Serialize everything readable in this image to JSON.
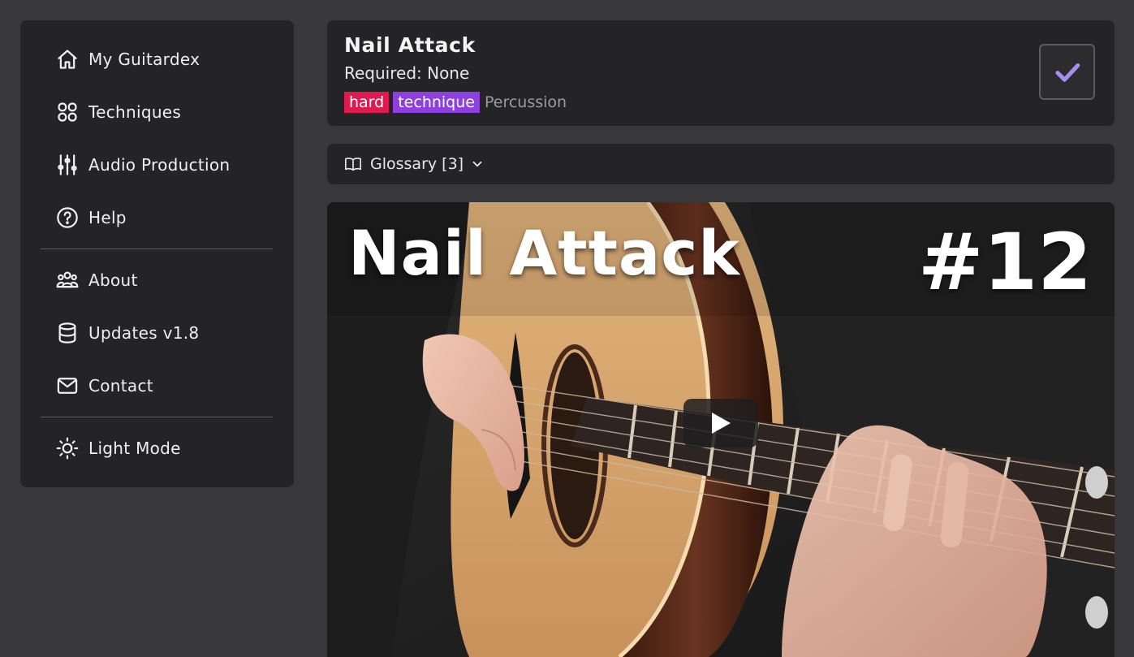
{
  "sidebar": {
    "items": [
      {
        "label": "My Guitardex",
        "icon": "home-icon"
      },
      {
        "label": "Techniques",
        "icon": "grid-icon"
      },
      {
        "label": "Audio Production",
        "icon": "sliders-icon"
      },
      {
        "label": "Help",
        "icon": "help-circle-icon"
      },
      {
        "label": "About",
        "icon": "users-icon"
      },
      {
        "label": "Updates v1.8",
        "icon": "database-icon"
      },
      {
        "label": "Contact",
        "icon": "mail-icon"
      },
      {
        "label": "Light Mode",
        "icon": "sun-icon"
      }
    ]
  },
  "header": {
    "title": "Nail Attack",
    "required": "Required: None",
    "tags": {
      "difficulty": "hard",
      "type": "technique",
      "category": "Percussion"
    },
    "complete_icon": "checkmark-icon"
  },
  "glossary": {
    "label": "Glossary [3]",
    "icon": "book-icon",
    "chevron": "chevron-down-icon"
  },
  "video": {
    "title": "Nail Attack",
    "number": "#12",
    "play_icon": "play-icon"
  },
  "colors": {
    "background": "#38383a",
    "panel": "#242426",
    "tag_hard": "#e0194f",
    "tag_technique": "#8e3fe0",
    "check_accent": "#a98cf0"
  }
}
